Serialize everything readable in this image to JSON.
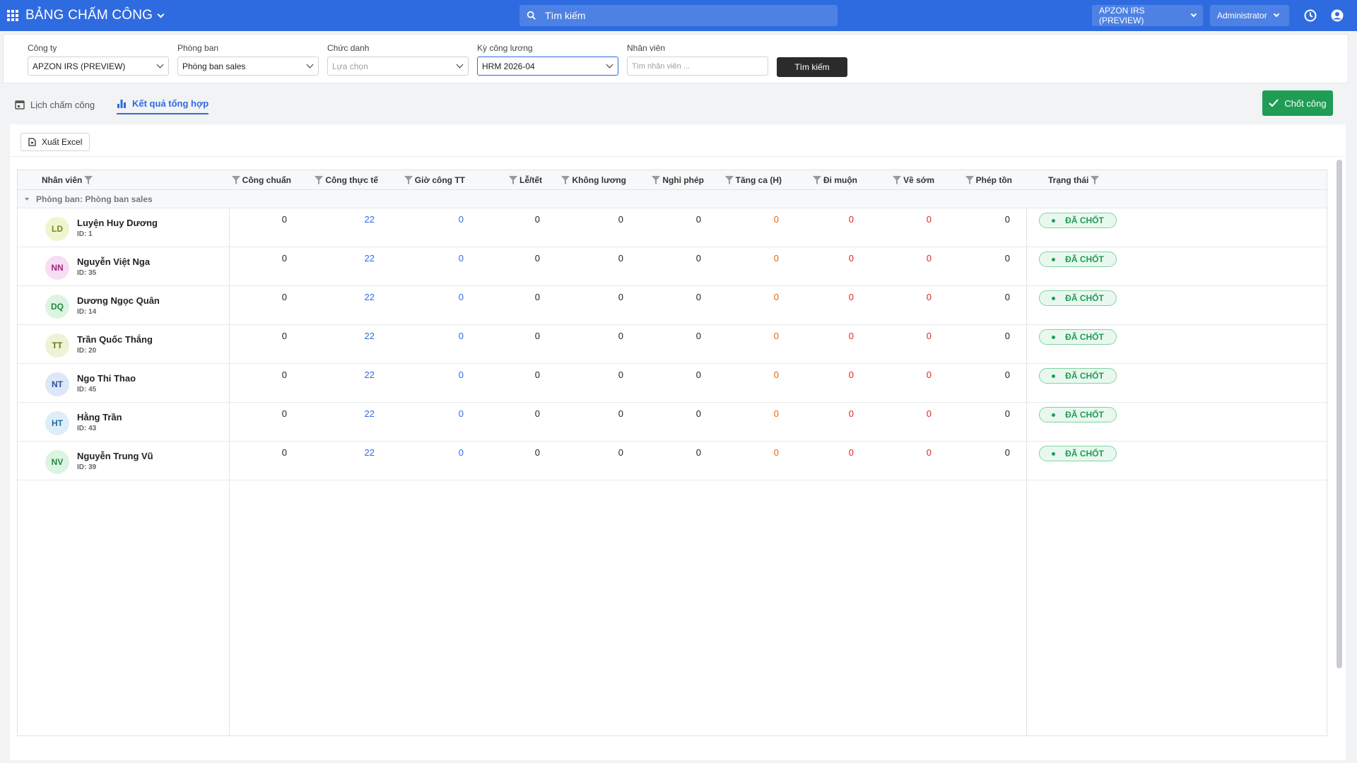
{
  "app": {
    "title": "BẢNG CHẤM CÔNG"
  },
  "topbar": {
    "search_placeholder": "Tìm kiếm",
    "company_switcher": "APZON IRS (PREVIEW)",
    "user_menu": "Administrator"
  },
  "filters": {
    "company": {
      "label": "Công ty",
      "value": "APZON IRS (PREVIEW)"
    },
    "department": {
      "label": "Phòng ban",
      "value": "Phòng ban sales"
    },
    "position": {
      "label": "Chức danh",
      "placeholder": "Lựa chọn"
    },
    "pay_period": {
      "label": "Kỳ công lương",
      "value": "HRM 2026-04"
    },
    "employee": {
      "label": "Nhân viên",
      "placeholder": "Tìm nhân viên ..."
    },
    "search_button": "Tìm kiếm"
  },
  "tabs": [
    {
      "label": "Lịch chấm công",
      "active": false
    },
    {
      "label": "Kết quả tổng hợp",
      "active": true
    }
  ],
  "lock_button": "Chốt công",
  "export_button": "Xuất Excel",
  "table": {
    "headers": {
      "employee": "Nhân viên",
      "cols": [
        "Công chuẩn",
        "Công thực tế",
        "Giờ công TT",
        "Lễ/tết",
        "Không lương",
        "Nghỉ phép",
        "Tăng ca (H)",
        "Đi muộn",
        "Về sớm",
        "Phép tồn"
      ],
      "status": "Trạng thái"
    },
    "group_label": "Phòng ban: Phòng ban sales",
    "rows": [
      {
        "initials": "LD",
        "name": "Luyện Huy Dương",
        "id": "ID: 1",
        "values": [
          "0",
          "22",
          "0",
          "0",
          "0",
          "0",
          "0",
          "0",
          "0",
          "0"
        ],
        "status": "ĐÃ CHỐT"
      },
      {
        "initials": "NN",
        "name": "Nguyễn Việt Nga",
        "id": "ID: 35",
        "values": [
          "0",
          "22",
          "0",
          "0",
          "0",
          "0",
          "0",
          "0",
          "0",
          "0"
        ],
        "status": "ĐÃ CHỐT"
      },
      {
        "initials": "DQ",
        "name": "Dương Ngọc Quân",
        "id": "ID: 14",
        "values": [
          "0",
          "22",
          "0",
          "0",
          "0",
          "0",
          "0",
          "0",
          "0",
          "0"
        ],
        "status": "ĐÃ CHỐT"
      },
      {
        "initials": "TT",
        "name": "Trần Quốc Thắng",
        "id": "ID: 20",
        "values": [
          "0",
          "22",
          "0",
          "0",
          "0",
          "0",
          "0",
          "0",
          "0",
          "0"
        ],
        "status": "ĐÃ CHỐT"
      },
      {
        "initials": "NT",
        "name": "Ngo Thi Thao",
        "id": "ID: 45",
        "values": [
          "0",
          "22",
          "0",
          "0",
          "0",
          "0",
          "0",
          "0",
          "0",
          "0"
        ],
        "status": "ĐÃ CHỐT"
      },
      {
        "initials": "HT",
        "name": "Hằng Trần",
        "id": "ID: 43",
        "values": [
          "0",
          "22",
          "0",
          "0",
          "0",
          "0",
          "0",
          "0",
          "0",
          "0"
        ],
        "status": "ĐÃ CHỐT"
      },
      {
        "initials": "NV",
        "name": "Nguyễn Trung Vũ",
        "id": "ID: 39",
        "values": [
          "0",
          "22",
          "0",
          "0",
          "0",
          "0",
          "0",
          "0",
          "0",
          "0"
        ],
        "status": "ĐÃ CHỐT"
      }
    ]
  },
  "colors": {
    "primary": "#2f6be0",
    "success": "#1f9d55",
    "overtime": "#e8630a",
    "late": "#e02424",
    "avatar_bg": [
      "#eef6cf",
      "#f6ddf3",
      "#dcf4e2",
      "#edf3d4",
      "#dde7f8",
      "#ddeefa",
      "#dcf4e2"
    ],
    "avatar_fg": [
      "#7a8a1a",
      "#a0287f",
      "#1f8a3e",
      "#6a7a1a",
      "#2a4f9a",
      "#2a6b9a",
      "#1f8a3e"
    ]
  }
}
